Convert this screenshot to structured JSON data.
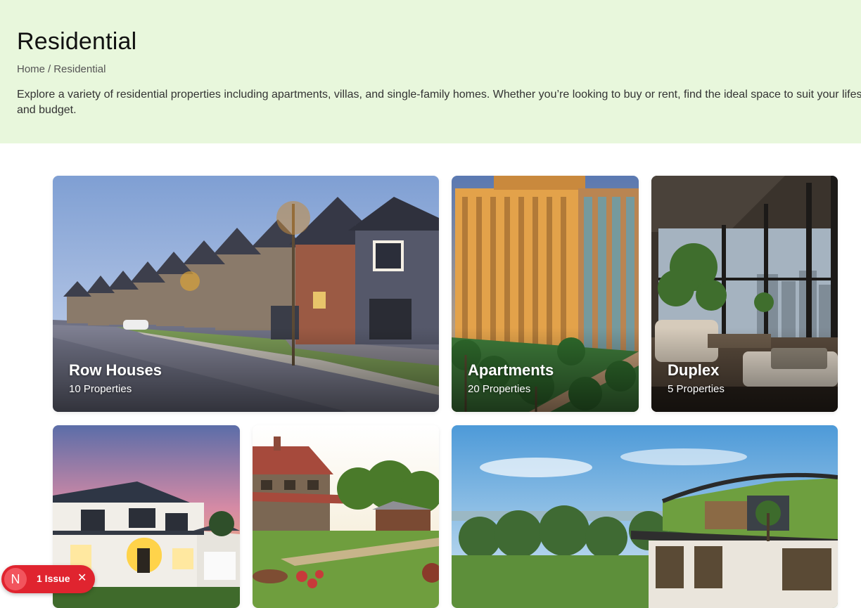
{
  "header": {
    "title": "Residential",
    "breadcrumb": {
      "home": "Home",
      "separator": "/",
      "current": "Residential"
    },
    "description": "Explore a variety of residential properties including apartments, villas, and single-family homes. Whether you’re looking to buy or rent, find the ideal space to suit your lifestyle and budget."
  },
  "categories": [
    {
      "title": "Row Houses",
      "count": "10 Properties",
      "image": "row-houses-photo"
    },
    {
      "title": "Apartments",
      "count": "20 Properties",
      "image": "apartments-photo"
    },
    {
      "title": "Duplex",
      "count": "5 Properties",
      "image": "duplex-photo"
    },
    {
      "title": "",
      "count": "",
      "image": "villa-photo"
    },
    {
      "title": "",
      "count": "",
      "image": "farmhouse-photo"
    },
    {
      "title": "",
      "count": "",
      "image": "green-roof-house-photo"
    }
  ],
  "issue_badge": {
    "logo": "N",
    "label": "1 Issue",
    "close": "✕"
  },
  "colors": {
    "hero_bg": "#e8f7dc",
    "badge_red": "#e0242f"
  }
}
